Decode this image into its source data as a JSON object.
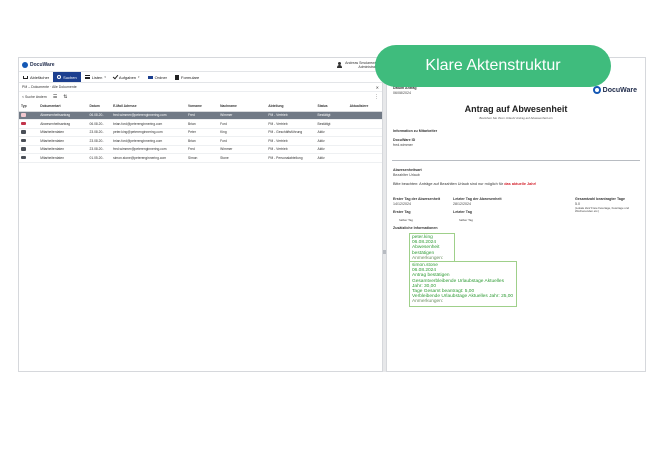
{
  "app": {
    "brand": "DocuWare",
    "user": {
      "name": "Andreas Smolarewski",
      "role": "Administrator"
    }
  },
  "menu": [
    {
      "label": "Ablefächer",
      "icon": "tray-icon",
      "active": false,
      "caret": false
    },
    {
      "label": "Suchen",
      "icon": "search-icon",
      "active": true,
      "caret": false
    },
    {
      "label": "Listen",
      "icon": "list-icon",
      "active": false,
      "caret": true
    },
    {
      "label": "Aufgaben",
      "icon": "check-icon",
      "active": false,
      "caret": true
    },
    {
      "label": "Ordner",
      "icon": "folder-icon",
      "active": false,
      "caret": false
    },
    {
      "label": "Formulare",
      "icon": "form-icon",
      "active": false,
      "caret": false
    }
  ],
  "path": "PM – Dokumente · Alle Dokumente",
  "toolbar": {
    "back_label": "< Suche ändern"
  },
  "table": {
    "columns": [
      "Typ",
      "Dokumentart",
      "Datum",
      "E-Mail Adresse",
      "Vorname",
      "Nachname",
      "Abteilung",
      "Status",
      "Aktualisiere"
    ],
    "rows": [
      {
        "type": "form",
        "selected": true,
        "cells": [
          "",
          "Abwesenheitsantrag",
          "06.08.20..",
          "fred.wimmer@peterenginnering.com",
          "Fred",
          "Wimmer",
          "PM - Vertrieb",
          "Bestätigt",
          ""
        ]
      },
      {
        "type": "form",
        "selected": false,
        "cells": [
          "",
          "Abwesenheitsantrag",
          "06.08.20..",
          "brian.ford@peterenginnering.com",
          "Brian",
          "Ford",
          "PM - Vertrieb",
          "Bestätigt",
          ""
        ]
      },
      {
        "type": "doc",
        "selected": false,
        "cells": [
          "",
          "Mitarbeiterdaten",
          "23.08.20..",
          "peter.king@peterenginnering.com",
          "Peter",
          "King",
          "PM - Geschäftsführung",
          "Aktiv",
          ""
        ]
      },
      {
        "type": "doc",
        "selected": false,
        "cells": [
          "",
          "Mitarbeiterdaten",
          "23.08.20..",
          "brian.ford@peterenginnering.com",
          "Brian",
          "Ford",
          "PM - Vertrieb",
          "Aktiv",
          ""
        ]
      },
      {
        "type": "doc",
        "selected": false,
        "cells": [
          "",
          "Mitarbeiterdaten",
          "23.08.20..",
          "fred.wimmer@peterenginnering.com",
          "Fred",
          "Wimmer",
          "PM - Vertrieb",
          "Aktiv",
          ""
        ]
      },
      {
        "type": "doc",
        "selected": false,
        "cells": [
          "",
          "Mitarbeiterdaten",
          "01.05.20..",
          "simon.stone@peterenginnering.com",
          "Simon",
          "Stone",
          "PM - Personalabteilung",
          "Aktiv",
          ""
        ]
      }
    ]
  },
  "document": {
    "date_label": "Datum Antrag",
    "date_value": "06/08/2024",
    "logo": "DocuWare",
    "title": "Antrag auf Abwesenheit",
    "subtitle": "Beziehen Sie Ihren Urlaub/ Antrag auf Abwesenheit ein",
    "employee_info_label": "Information zu Mitarbeiter",
    "docuware_id_label": "DocuWare ID",
    "docuware_id_value": "fred.wimmer",
    "absence_type_label": "Abwesenheitsart",
    "absence_type_value": "Bezahlter Urlaub",
    "note_text": "Bitte beachten: Anträge auf Bezahlten Urlaub sind nur möglich für ",
    "note_highlight": "das aktuelle Jahr!",
    "first_day_label": "Erster Tag der Abwesenheit",
    "first_day_value": "14/12/2024",
    "last_day_label": "Letzter Tag der Abwesenheit",
    "last_day_value": "28/12/2024",
    "total_days_label": "Gesamtzahl beantragter Tage",
    "total_days_value": "5.0",
    "total_days_note": "(Lokale Zeit/ Freie Feiertage, Feiertage und Wochenenden etc.)",
    "first_day_half_label": "Erster Tag",
    "first_day_half_value": "halber Tag",
    "last_day_half_label": "Letzter Tag",
    "last_day_half_value": "halber Tag",
    "additional_info_label": "Zusätzliche Informationen",
    "annotation1": [
      "peter.king",
      "06.08.2024",
      "Abwesenheit bestätigen",
      "Anmerkungen:"
    ],
    "annotation2": [
      "simon.stone",
      "06.08.2024",
      "Antrag bestätigen",
      "Gesamtverbleibende Urlaubstage Aktuelles Jahr: 30,00",
      "Tage Gesamt beantragt: 5,00",
      "Verbleibende Urlaubstage Aktuelles Jahr: 25,00",
      "Anmerkungen:"
    ]
  },
  "banner": {
    "label": "Klare Aktenstruktur"
  },
  "colors": {
    "banner": "#3fbc7d",
    "nav_active": "#1c3f8f",
    "selected_row": "#717a86",
    "form_icon": "#c2344b",
    "annotation_text": "#2e9b34"
  }
}
